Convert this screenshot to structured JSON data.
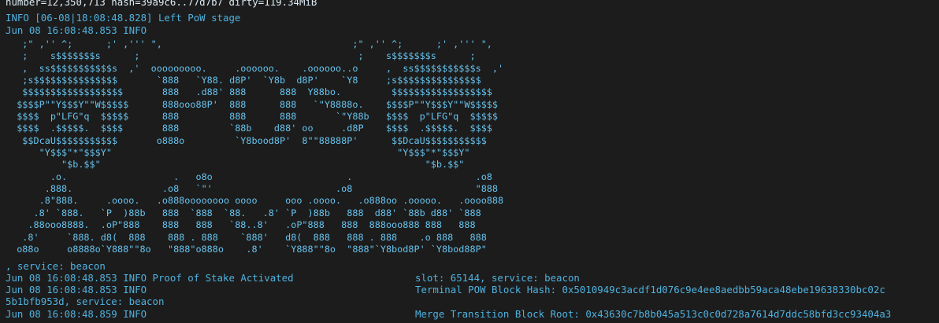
{
  "terminal": {
    "lines_top": [
      "number=12,350,713 hash=39a9c6..77d7b7 dirty=119.34MiB",
      "INFO [06-08|18:08:48.828] Left PoW stage",
      "Jun 08 16:08:48.853 INFO"
    ],
    "ascii_art": "   ;\" ,'' ^;      ;' ,''' \",                                  ;\" ,'' ^;      ;' ,''' \",\n   ;    s$$$$$$$s      ;                                       ;    s$$$$$$$s      ;\n   ,  ss$$$$$$$$$$$s  ,'  ooooooooo.     .oooooo.    .oooooo..o     ,  ss$$$$$$$$$$$s  ,'\n   ;s$$$$$$$$$$$$$$$       `888   `Y88. d8P'  `Y8b  d8P'    `Y8     ;s$$$$$$$$$$$$$$$\n   $$$$$$$$$$$$$$$$$$       888   .d88' 888      888  Y88bo.         $$$$$$$$$$$$$$$$$$\n  $$$$P\"\"Y$$$Y\"\"W$$$$$      888ooo88P'  888      888   `\"Y8888o.    $$$$P\"\"Y$$$Y\"\"W$$$$$\n  $$$$  p\"LFG\"q  $$$$$      888         888      888       `\"Y88b   $$$$  p\"LFG\"q  $$$$$\n  $$$$  .$$$$$.  $$$$       888         `88b    d88' oo     .d8P    $$$$  .$$$$$.  $$$$\n   $$DcaU$$$$$$$$$$$       o888o         `Y8bood8P'  8\"\"88888P'      $$DcaU$$$$$$$$$$$\n      \"Y$$$\"*\"$$$Y\"                                                   \"Y$$$\"*\"$$$Y\"\n          \"$b.$$\"                                                          \"$b.$$\"\n        .o.                   .   o8o                        .                      .o8\n       .888.                .o8   `\"'                      .o8                      \"888\n      .8\"888.     .oooo.   .o888oooooooo oooo     ooo .oooo.   .o888oo .ooooo.   .oooo888\n     .8' `888.   `P  )88b   888  `888  `88.   .8' `P  )88b   888  d88' `88b d88' `888\n    .88ooo8888.  .oP\"888    888   888   `88..8'   .oP\"888   888  888ooo888 888   888\n   .8'     `888. d8(  888    888 . 888    `888'   d8(  888   888 . 888    .o 888   888\n  o88o     o8888o`Y888\"\"8o   \"888\"o888o    .8'    `Y888\"\"8o  \"888\"`Y8bod8P' `Y8bod88P\"",
    "lines_bottom": [
      ", service: beacon",
      "Jun 08 16:08:48.853 INFO Proof of Stake Activated",
      "Jun 08 16:08:48.853 INFO",
      "5b1bfb953d, service: beacon",
      "Jun 08 16:08:48.859 INFO"
    ],
    "lines_right": [
      "slot: 65144, service: beacon",
      "Terminal POW Block Hash: 0x5010949c3acdf1d076c9e4ee8aedbb59aca48ebe19638330bc02c",
      "Merge Transition Block Root: 0x43630c7b8b045a513c0c0d728a7614d7ddc58bfd3cc93404a3"
    ]
  }
}
